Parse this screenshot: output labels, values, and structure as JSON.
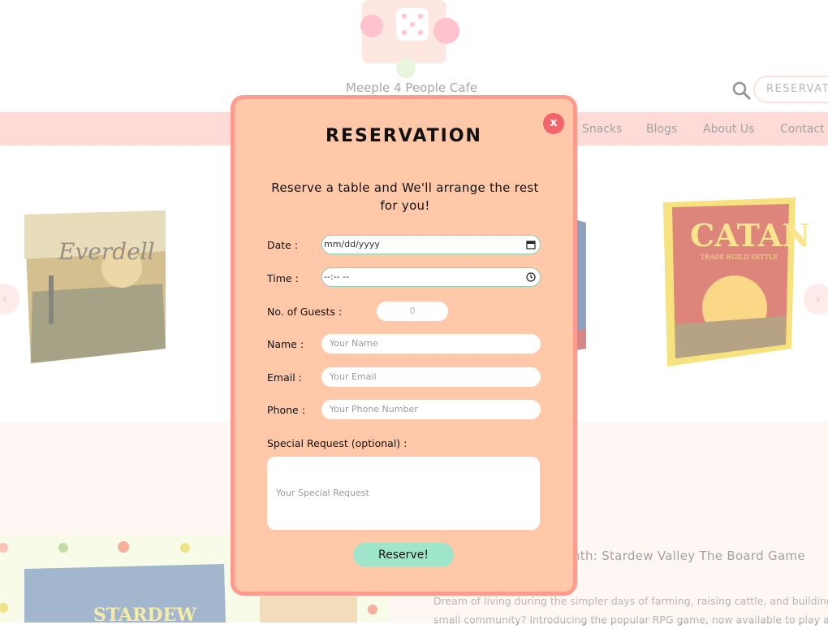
{
  "header": {
    "site_name": "Meeple 4 People Cafe",
    "reservation_button": "RESERVAT"
  },
  "nav": {
    "items": [
      "Snacks",
      "Blogs",
      "About Us",
      "Contact U"
    ]
  },
  "carousel": {
    "games": [
      "Everdell",
      "CATAN"
    ],
    "catan_tagline": "TRADE BUILD SETTLE",
    "prev_icon": "chevron-left-icon",
    "next_icon": "chevron-right-icon"
  },
  "article": {
    "title": "nth: Stardew Valley The Board Game",
    "line1": "Dream of living during the simpler days of farming, raising cattle, and building",
    "line2": "small community? Introducing the popular RPG game, now available to play a",
    "image_title": "STARDEW"
  },
  "modal": {
    "close_label": "x",
    "title": "RESERVATION",
    "subtitle": "Reserve a table and We'll arrange the rest for you!",
    "date_label": "Date :",
    "date_value": "mm/dd/yyyy",
    "time_label": "Time :",
    "time_value": "--:-- --",
    "guests_label": "No. of Guests :",
    "guests_value": "0",
    "name_label": "Name :",
    "name_placeholder": "Your Name",
    "email_label": "Email :",
    "email_placeholder": "Your Email",
    "phone_label": "Phone :",
    "phone_placeholder": "Your Phone Number",
    "request_label": "Special Request (optional) :",
    "request_placeholder": "Your Special Request",
    "submit_label": "Reserve!"
  },
  "colors": {
    "nav_bg": "#ffc5c0",
    "modal_bg": "#ffc8a8",
    "modal_border": "#ff9a8f",
    "close_bg": "#f3636a",
    "submit_bg": "#9fe5ca",
    "section_bg": "#fff3ec"
  }
}
